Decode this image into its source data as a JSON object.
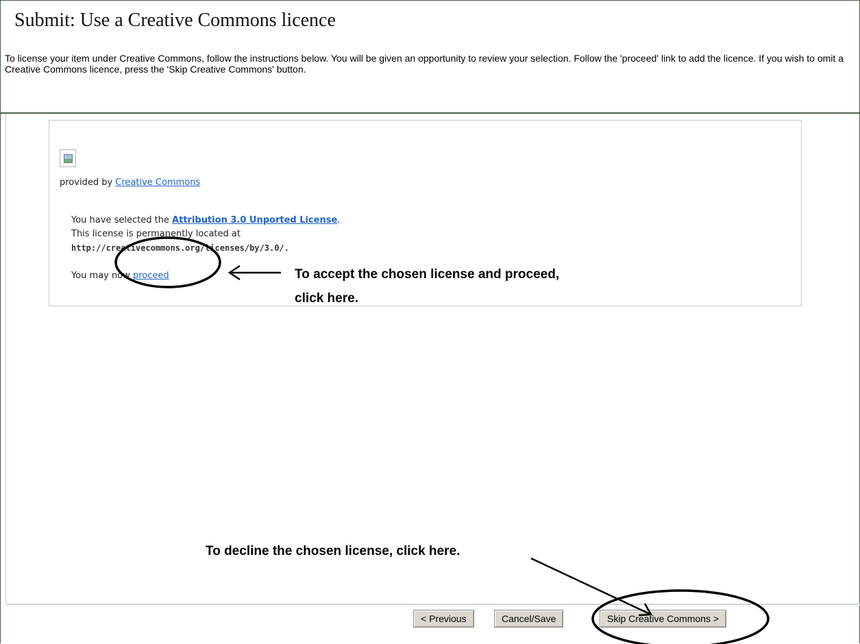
{
  "page": {
    "title": "Submit: Use a Creative Commons licence",
    "intro": "To license your item under Creative Commons, follow the instructions below. You will be given an opportunity to review your selection. Follow the 'proceed' link to add the licence. If you wish to omit a Creative Commons licence, press the 'Skip Creative Commons' button."
  },
  "license_panel": {
    "provided_prefix": "provided by ",
    "provided_link": "Creative Commons",
    "selected_prefix": "You have selected the ",
    "license_name": "Attribution 3.0 Unported License",
    "selected_suffix": ".",
    "located_text": "This license is permanently located at",
    "license_url": "http://creativecommons.org/licenses/by/3.0/",
    "url_suffix": ".",
    "proceed_prefix": "You may now ",
    "proceed_link": "proceed"
  },
  "annotations": {
    "accept_line1": "To accept the chosen license and proceed,",
    "accept_line2": "click here.",
    "decline": "To decline the chosen license, click here."
  },
  "buttons": {
    "previous": "< Previous",
    "cancel_save": "Cancel/Save",
    "skip": "Skip Creative Commons >"
  }
}
